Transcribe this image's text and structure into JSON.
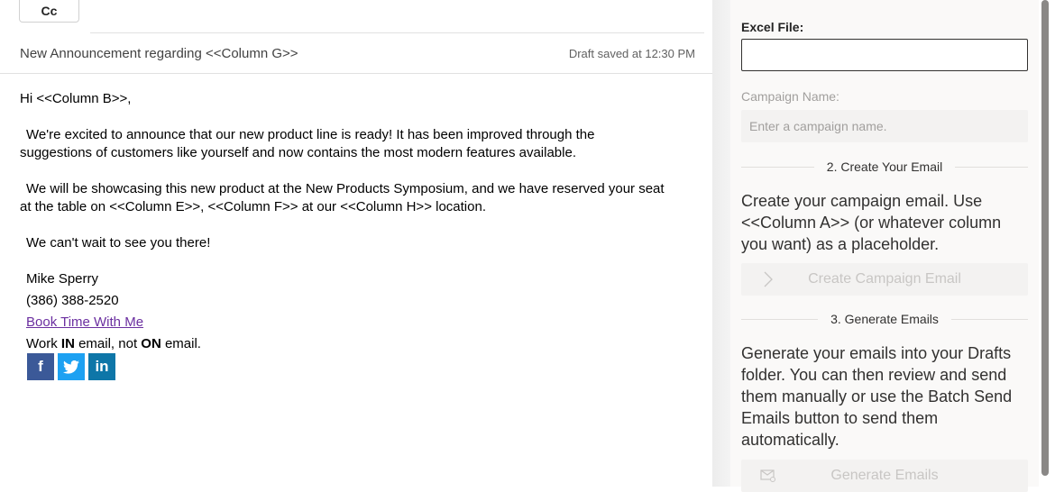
{
  "compose": {
    "cc_label": "Cc",
    "subject": "New Announcement regarding <<Column G>>",
    "draft_status": "Draft saved at 12:30 PM",
    "body": {
      "greeting": "Hi <<Column B>>,",
      "para1_line1": "We're excited to announce that our new product line is ready!  It has been improved through the",
      "para1_line2": "suggestions of customers like yourself and now contains the most modern features available.",
      "para2_line1": "We will be showcasing this new product at the New Products Symposium, and we have reserved your seat",
      "para2_line2": "at the table on <<Column E>>, <<Column F>> at our <<Column H>> location.",
      "para3": "We can't wait to see you there!",
      "sig_name": "Mike Sperry",
      "sig_phone": "(386) 388-2520",
      "sig_link": "Book Time With Me",
      "tagline_work": "Work ",
      "tagline_in": "IN",
      "tagline_mid": " email, not ",
      "tagline_on": "ON",
      "tagline_end": " email."
    },
    "social": {
      "facebook": "f",
      "twitter": "🐦",
      "linkedin": "in"
    }
  },
  "pane": {
    "excel_label": "Excel File:",
    "campaign_name_label": "Campaign Name:",
    "campaign_name_placeholder": "Enter a campaign name.",
    "step2_title": "2. Create Your Email",
    "step2_desc": "Create your campaign email. Use <<Column A>> (or whatever column you want) as a placeholder.",
    "create_button": "Create Campaign Email",
    "step3_title": "3. Generate Emails",
    "step3_desc": "Generate your emails into your Drafts folder. You can then review and send them manually or use the Batch Send Emails button to send them automatically.",
    "generate_button": "Generate Emails"
  },
  "colors": {
    "link": "#6b2fa0",
    "facebook": "#3b5998",
    "twitter": "#1da1f2",
    "linkedin": "#0e76a8"
  }
}
